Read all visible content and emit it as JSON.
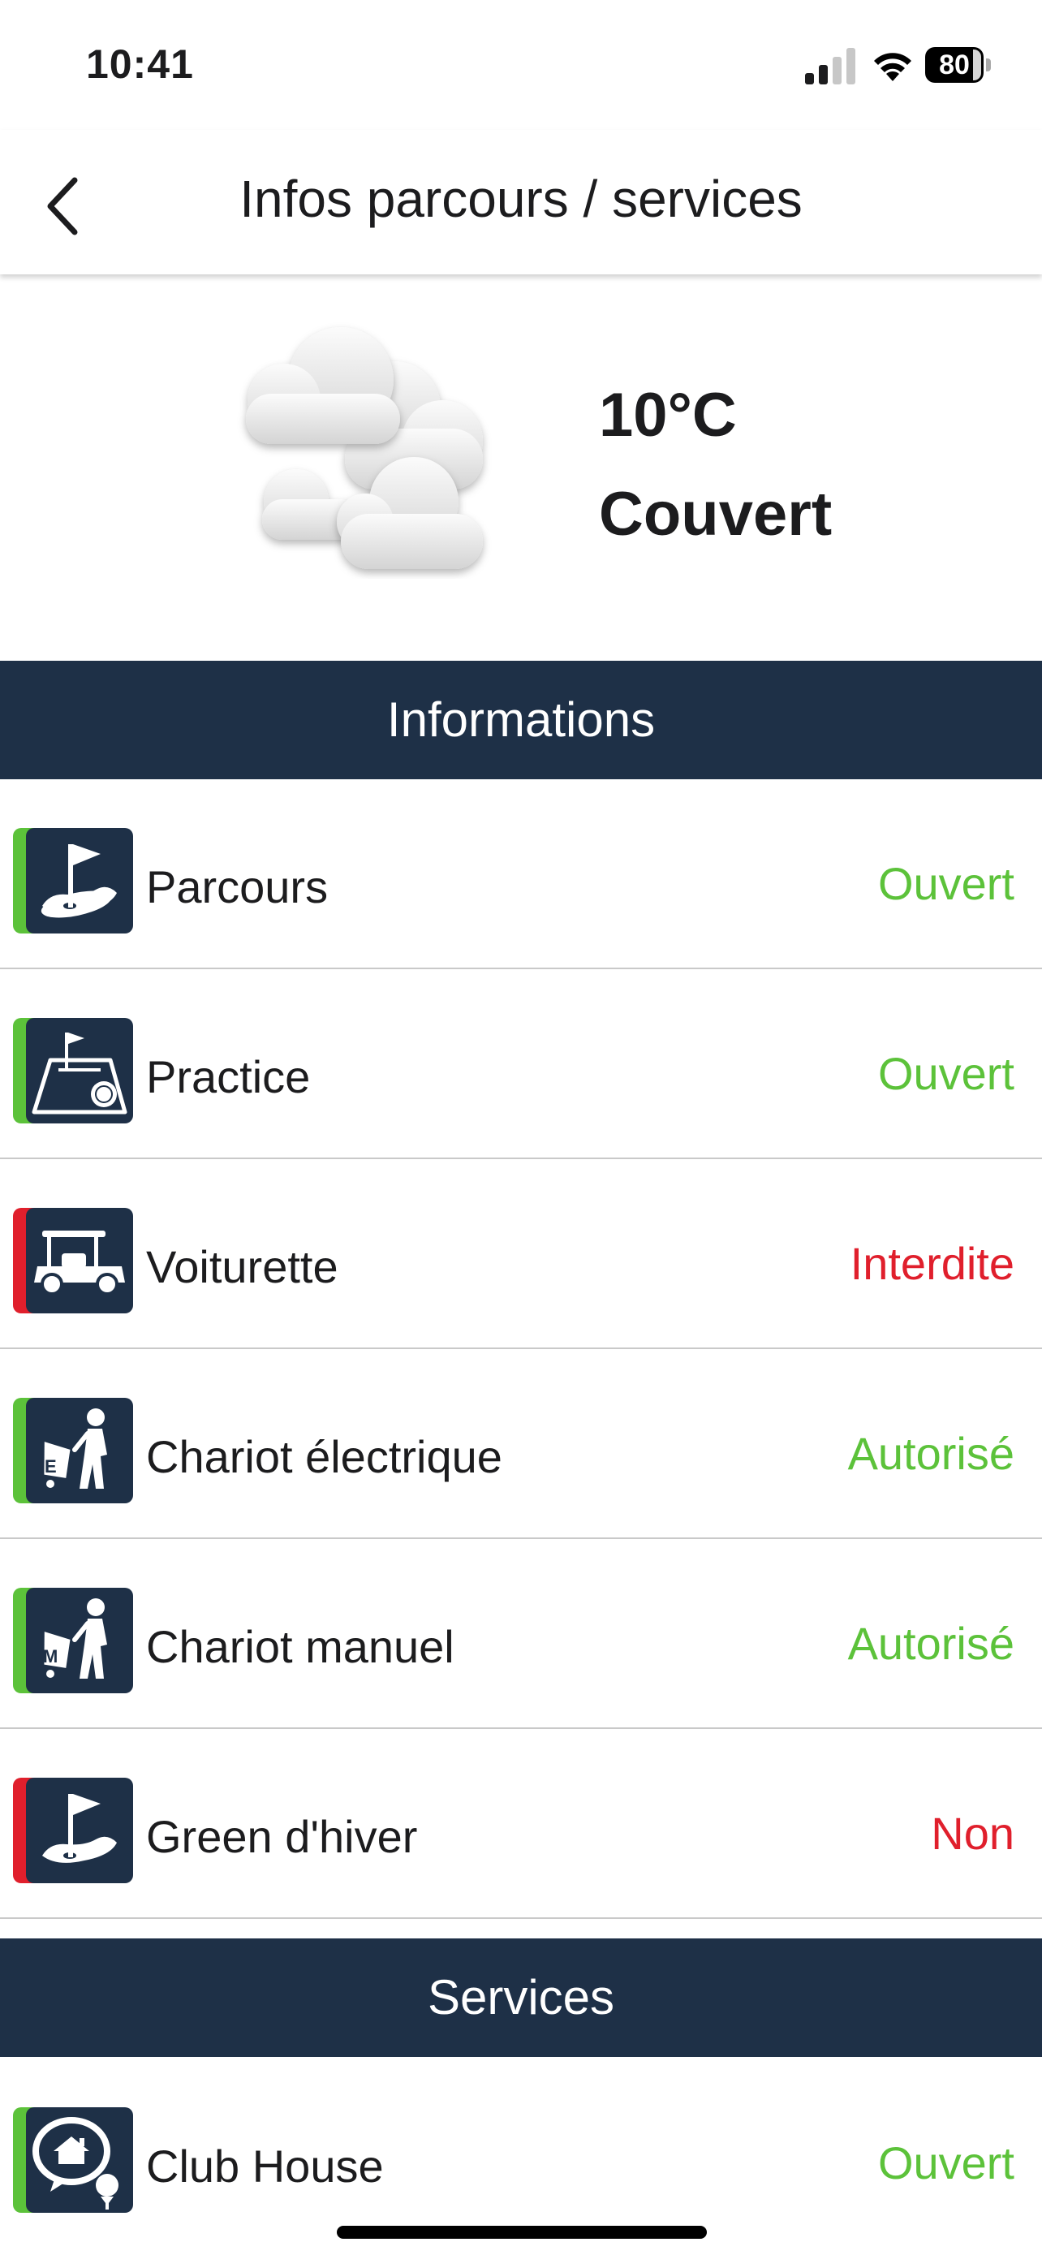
{
  "status_bar": {
    "time": "10:41",
    "battery": "80"
  },
  "nav": {
    "title": "Infos parcours / services",
    "back_icon": "chevron-left-icon"
  },
  "weather": {
    "temperature": "10°C",
    "condition": "Couvert",
    "icon": "cloudy-icon"
  },
  "colors": {
    "header_bg": "#1e3047",
    "open": "#5cc23a",
    "closed": "#e01f2c"
  },
  "informations": {
    "title": "Informations",
    "items": [
      {
        "label": "Parcours",
        "value": "Ouvert",
        "status": "green",
        "icon": "golf-flag-green-icon"
      },
      {
        "label": "Practice",
        "value": "Ouvert",
        "status": "green",
        "icon": "driving-range-icon"
      },
      {
        "label": "Voiturette",
        "value": "Interdite",
        "status": "red",
        "icon": "golf-cart-icon"
      },
      {
        "label": "Chariot électrique",
        "value": "Autorisé",
        "status": "green",
        "icon": "electric-trolley-icon"
      },
      {
        "label": "Chariot manuel",
        "value": "Autorisé",
        "status": "green",
        "icon": "manual-trolley-icon"
      },
      {
        "label": "Green d'hiver",
        "value": "Non",
        "status": "red",
        "icon": "winter-green-icon"
      }
    ]
  },
  "services": {
    "title": "Services",
    "items": [
      {
        "label": "Club House",
        "value": "Ouvert",
        "status": "green",
        "icon": "club-house-icon"
      }
    ]
  }
}
